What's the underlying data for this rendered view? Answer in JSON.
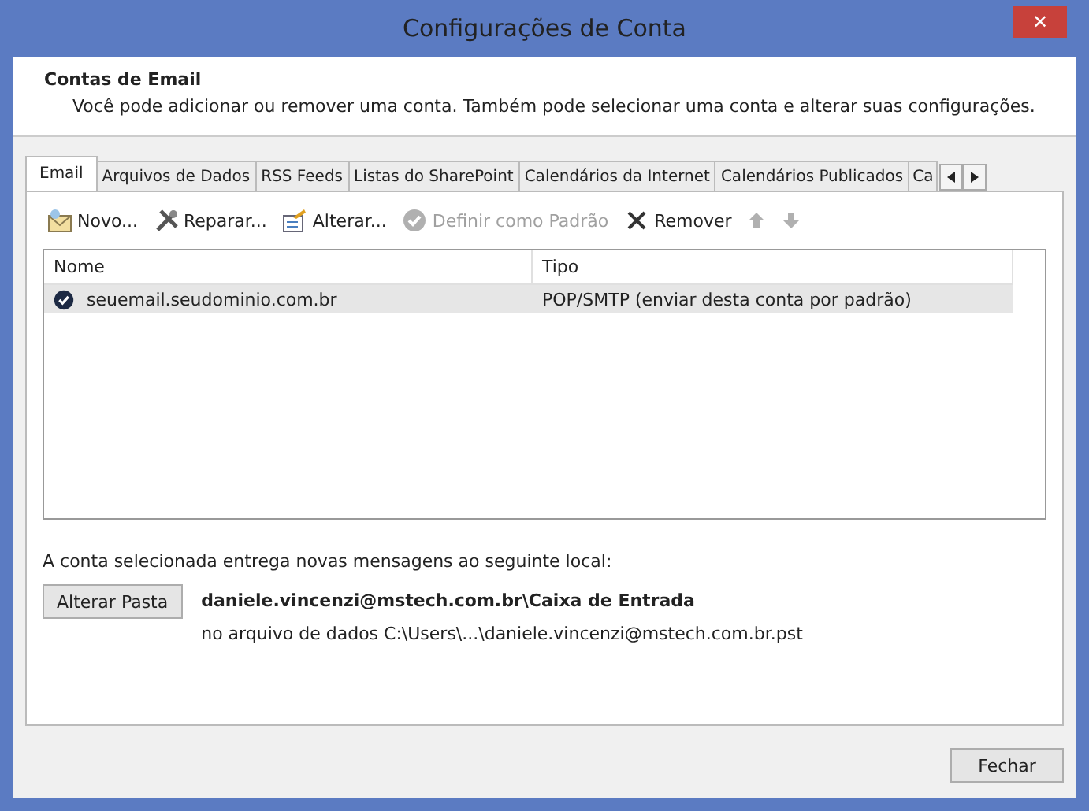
{
  "window": {
    "title": "Configurações de Conta",
    "close": "✕"
  },
  "header": {
    "title": "Contas de Email",
    "description": "Você pode adicionar ou remover uma conta. Também pode selecionar uma conta e alterar suas configurações."
  },
  "tabs": [
    {
      "label": "Email",
      "selected": true
    },
    {
      "label": "Arquivos de Dados",
      "selected": false
    },
    {
      "label": "RSS Feeds",
      "selected": false
    },
    {
      "label": "Listas do SharePoint",
      "selected": false
    },
    {
      "label": "Calendários da Internet",
      "selected": false
    },
    {
      "label": "Calendários Publicados",
      "selected": false
    },
    {
      "label": "Ca",
      "selected": false
    }
  ],
  "toolbar": [
    {
      "kind": "new",
      "label": "Novo...",
      "disabled": false
    },
    {
      "kind": "repair",
      "label": "Reparar...",
      "disabled": false
    },
    {
      "kind": "change",
      "label": "Alterar...",
      "disabled": false
    },
    {
      "kind": "default",
      "label": "Definir como Padrão",
      "disabled": true
    },
    {
      "kind": "remove",
      "label": "Remover",
      "disabled": false
    },
    {
      "kind": "up",
      "disabled": true
    },
    {
      "kind": "down",
      "disabled": true
    }
  ],
  "table": {
    "columns": [
      "Nome",
      "Tipo"
    ],
    "rows": [
      {
        "name": "seuemail.seudominio.com.br",
        "type": "POP/SMTP (enviar desta conta por padrão)",
        "selected": true,
        "default": true
      }
    ]
  },
  "delivery": {
    "label": "A conta selecionada entrega novas mensagens ao seguinte local:",
    "button": "Alterar Pasta",
    "folder": "daniele.vincenzi@mstech.com.br\\Caixa de Entrada",
    "file": "no arquivo de dados C:\\Users\\...\\daniele.vincenzi@mstech.com.br.pst"
  },
  "buttons": [
    "Fechar"
  ]
}
